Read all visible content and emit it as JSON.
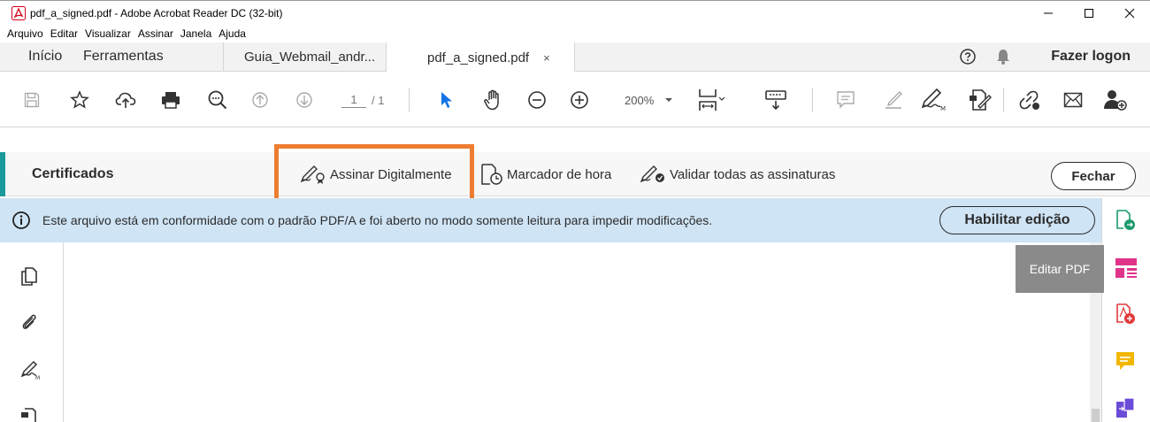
{
  "window": {
    "title": "pdf_a_signed.pdf - Adobe Acrobat Reader DC (32-bit)"
  },
  "menu": [
    "Arquivo",
    "Editar",
    "Visualizar",
    "Assinar",
    "Janela",
    "Ajuda"
  ],
  "tabs": {
    "home": "Início",
    "tools": "Ferramentas",
    "doc1": "Guia_Webmail_andr...",
    "doc2": "pdf_a_signed.pdf",
    "close": "×",
    "login": "Fazer logon"
  },
  "toolbar": {
    "page_current": "1",
    "page_total": "/ 1",
    "zoom": "200%"
  },
  "certificates": {
    "title": "Certificados",
    "sign_digitally": "Assinar Digitalmente",
    "timestamp": "Marcador de hora",
    "validate_all": "Validar todas as assinaturas",
    "close": "Fechar"
  },
  "info": {
    "message": "Este arquivo está em conformidade com o padrão PDF/A e foi aberto no modo somente leitura para impedir modificações.",
    "enable_edit": "Habilitar edição"
  },
  "tooltip": "Editar PDF",
  "colors": {
    "highlight": "#ed7d31",
    "accent_teal": "#1a9a9a",
    "info_bg": "#cfe4f5",
    "cursor_blue": "#1473e6"
  }
}
